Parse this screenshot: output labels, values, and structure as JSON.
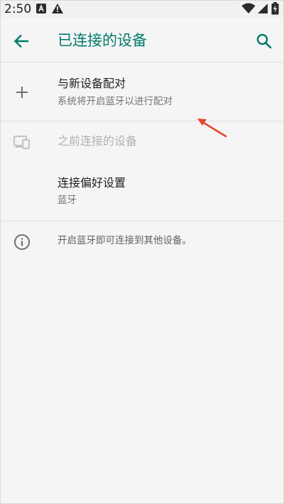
{
  "status_bar": {
    "time": "2:50",
    "icons": [
      "a-badge-icon",
      "warning-icon",
      "wifi-icon",
      "signal-icon",
      "battery-icon"
    ]
  },
  "app_bar": {
    "title": "已连接的设备",
    "back_icon": "arrow-back-icon",
    "search_icon": "search-icon",
    "accent_color": "#00796b"
  },
  "list": {
    "pair_new": {
      "title": "与新设备配对",
      "subtitle": "系统将开启蓝牙以进行配对",
      "icon": "plus-icon"
    },
    "previously_connected": {
      "title": "之前连接的设备",
      "icon": "devices-icon",
      "enabled": false
    },
    "connection_prefs": {
      "title": "连接偏好设置",
      "subtitle": "蓝牙"
    },
    "info": {
      "text": "开启蓝牙即可连接到其他设备。",
      "icon": "info-icon"
    }
  },
  "annotation": {
    "icon": "red-arrow-icon",
    "color": "#e8462e"
  }
}
